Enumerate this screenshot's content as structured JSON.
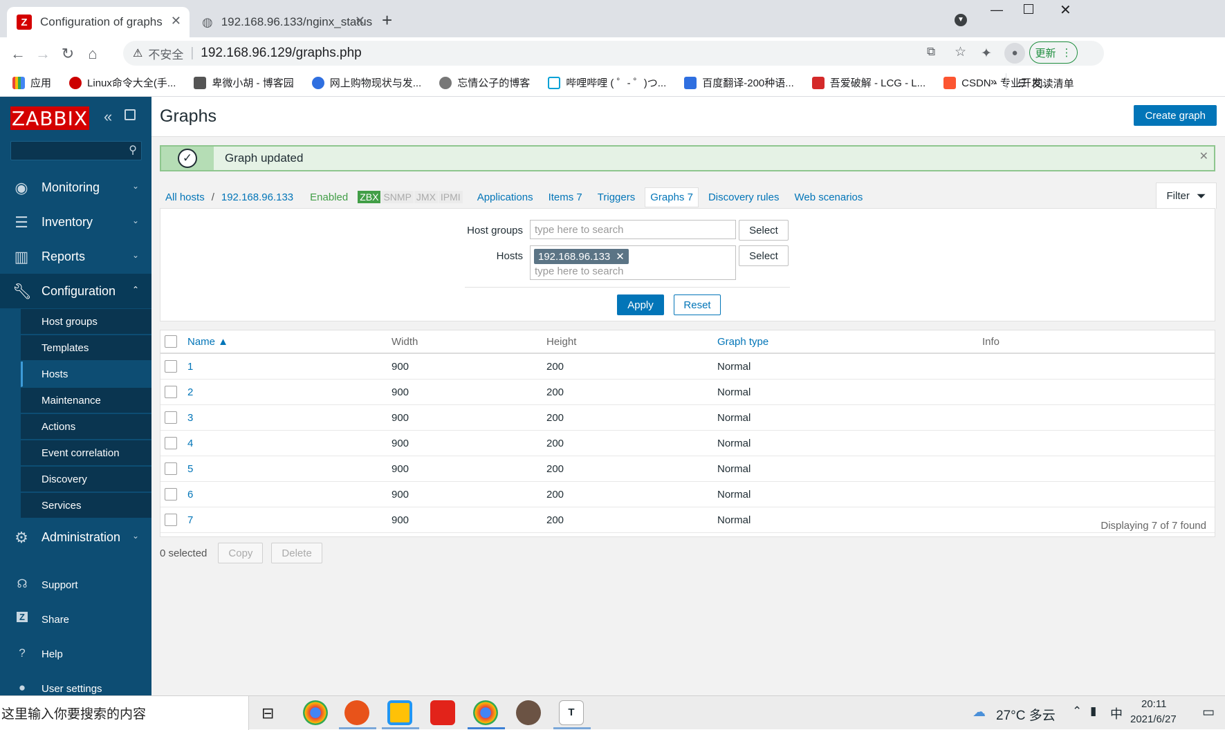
{
  "browser": {
    "tabs": [
      {
        "title": "Configuration of graphs",
        "favicon": "Z"
      },
      {
        "title": "192.168.96.133/nginx_status"
      }
    ],
    "security_label": "不安全",
    "url": "192.168.96.129/graphs.php",
    "update_label": "更新",
    "bookmarks": [
      "应用",
      "Linux命令大全(手...",
      "卑微小胡 - 博客园",
      "网上购物现状与发...",
      "忘情公子的博客",
      "哔哩哔哩 ( ゜- ゜)つ...",
      "百度翻译-200种语...",
      "吾爱破解 - LCG - L...",
      "CSDN - 专业开发..."
    ],
    "overflow_label": "»",
    "reading_list": "阅读清单"
  },
  "sidebar": {
    "logo": "ZABBIX",
    "menu": {
      "monitoring": "Monitoring",
      "inventory": "Inventory",
      "reports": "Reports",
      "configuration": "Configuration",
      "administration": "Administration"
    },
    "config_items": [
      "Host groups",
      "Templates",
      "Hosts",
      "Maintenance",
      "Actions",
      "Event correlation",
      "Discovery",
      "Services"
    ],
    "footer": {
      "support": "Support",
      "share": "Share",
      "help": "Help",
      "user_settings": "User settings"
    }
  },
  "page": {
    "title": "Graphs",
    "create_button": "Create graph",
    "message": "Graph updated",
    "breadcrumb": {
      "all_hosts": "All hosts",
      "host": "192.168.96.133",
      "status": "Enabled",
      "tags": [
        "ZBX",
        "SNMP",
        "JMX",
        "IPMI"
      ],
      "applications": "Applications",
      "items": "Items 7",
      "triggers": "Triggers",
      "graphs": "Graphs 7",
      "discovery": "Discovery rules",
      "web": "Web scenarios"
    },
    "filter": {
      "tab_label": "Filter",
      "host_groups_label": "Host groups",
      "hosts_label": "Hosts",
      "placeholder": "type here to search",
      "selected_host": "192.168.96.133",
      "select_label": "Select",
      "apply": "Apply",
      "reset": "Reset"
    },
    "table": {
      "headers": {
        "name": "Name ▲",
        "width": "Width",
        "height": "Height",
        "graph_type": "Graph type",
        "info": "Info"
      },
      "rows": [
        {
          "name": "1",
          "width": "900",
          "height": "200",
          "type": "Normal"
        },
        {
          "name": "2",
          "width": "900",
          "height": "200",
          "type": "Normal"
        },
        {
          "name": "3",
          "width": "900",
          "height": "200",
          "type": "Normal"
        },
        {
          "name": "4",
          "width": "900",
          "height": "200",
          "type": "Normal"
        },
        {
          "name": "5",
          "width": "900",
          "height": "200",
          "type": "Normal"
        },
        {
          "name": "6",
          "width": "900",
          "height": "200",
          "type": "Normal"
        },
        {
          "name": "7",
          "width": "900",
          "height": "200",
          "type": "Normal"
        }
      ],
      "footer": "Displaying 7 of 7 found"
    },
    "bottom": {
      "selected": "0 selected",
      "copy": "Copy",
      "delete": "Delete"
    }
  },
  "taskbar": {
    "search_placeholder": "这里输入你要搜索的内容",
    "weather": "27°C 多云",
    "ime": "中",
    "time": "20:11",
    "date": "2021/6/27"
  },
  "colors": {
    "brand": "#d40000",
    "sidebar": "#0d4d73",
    "accent": "#0275b8",
    "success": "#8ec68e"
  }
}
